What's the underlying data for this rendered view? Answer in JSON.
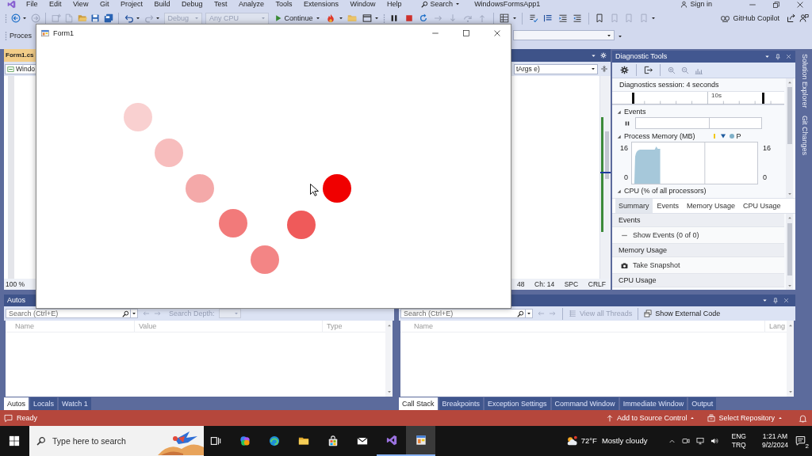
{
  "menu_bar": {
    "items": [
      "File",
      "Edit",
      "View",
      "Git",
      "Project",
      "Build",
      "Debug",
      "Test",
      "Analyze",
      "Tools",
      "Extensions",
      "Window",
      "Help"
    ],
    "search": "Search",
    "solution_name": "WindowsFormsApp1",
    "sign_in": "Sign in"
  },
  "toolbar": {
    "configuration": {
      "label": "Debug",
      "disabled": true
    },
    "platform": {
      "label": "Any CPU",
      "disabled": true
    },
    "continue": "Continue",
    "copilot": "GitHub Copilot"
  },
  "debug_location": {
    "label": "Proces"
  },
  "editor": {
    "tab": "Form1.cs",
    "type_dropdown": "Windo",
    "member_dropdown": "tArgs e)",
    "zoom": "100 %",
    "line": "48",
    "column": "Ch: 14",
    "whitespace": "SPC",
    "line_ending": "CRLF"
  },
  "form_window": {
    "title": "Form1",
    "circles": [
      {
        "color": "#f9d0d0"
      },
      {
        "color": "#f7bdbd"
      },
      {
        "color": "#f4a9a9"
      },
      {
        "color": "#f27a7a"
      },
      {
        "color": "#f38585"
      },
      {
        "color": "#ef5a5a"
      },
      {
        "color": "#f00000"
      }
    ]
  },
  "diagnostic_tools": {
    "title": "Diagnostic Tools",
    "session": "Diagnostics session: 4 seconds",
    "ruler_label": "10s",
    "graphs": [
      {
        "kind": "events",
        "label": "Events",
        "expanded": true
      },
      {
        "kind": "memory",
        "label": "Process Memory (MB)",
        "expanded": true,
        "legend_label": "P",
        "left_axis": [
          "16",
          "0"
        ],
        "right_axis": [
          "16",
          "0"
        ]
      },
      {
        "kind": "cpu",
        "label": "CPU (% of all processors)",
        "expanded": true
      }
    ],
    "tabs": [
      {
        "label": "Summary",
        "selected": true
      },
      {
        "label": "Events",
        "selected": false
      },
      {
        "label": "Memory Usage",
        "selected": false
      },
      {
        "label": "CPU Usage",
        "selected": false
      }
    ],
    "summary": [
      {
        "kind": "header",
        "label": "Events"
      },
      {
        "kind": "command",
        "label": "Show Events (0 of 0)"
      },
      {
        "kind": "header",
        "label": "Memory Usage"
      },
      {
        "kind": "command",
        "label": "Take Snapshot"
      },
      {
        "kind": "header",
        "label": "CPU Usage"
      }
    ]
  },
  "side_tabs": [
    "Solution Explorer",
    "Git Changes"
  ],
  "autos_panel": {
    "title": "Autos",
    "search_placeholder": "Search (Ctrl+E)",
    "search_depth": {
      "label": "Search Depth:",
      "disabled": true
    },
    "columns": [
      "Name",
      "Value",
      "Type"
    ],
    "tabs": [
      {
        "label": "Autos",
        "selected": true
      },
      {
        "label": "Locals",
        "selected": false
      },
      {
        "label": "Watch 1",
        "selected": false
      }
    ]
  },
  "call_stack_panel": {
    "search_placeholder": "Search (Ctrl+E)",
    "buttons": [
      {
        "label": "View all Threads",
        "disabled": true
      },
      {
        "label": "Show External Code",
        "disabled": false
      }
    ],
    "columns": [
      "Name",
      "Lang"
    ],
    "tabs": [
      {
        "label": "Call Stack",
        "selected": true
      },
      {
        "label": "Breakpoints",
        "selected": false
      },
      {
        "label": "Exception Settings",
        "selected": false
      },
      {
        "label": "Command Window",
        "selected": false
      },
      {
        "label": "Immediate Window",
        "selected": false
      },
      {
        "label": "Output",
        "selected": false
      }
    ]
  },
  "status_bar": {
    "message": "Ready",
    "source_control": "Add to Source Control",
    "repository": "Select Repository"
  },
  "taskbar": {
    "search_placeholder": "Type here to search",
    "apps": [
      {
        "running": false,
        "active": false
      },
      {
        "running": false,
        "active": false
      },
      {
        "running": false,
        "active": false
      },
      {
        "running": false,
        "active": false
      },
      {
        "running": false,
        "active": false
      },
      {
        "running": false,
        "active": false
      },
      {
        "running": true,
        "active": false
      },
      {
        "running": true,
        "active": true
      }
    ],
    "weather": {
      "temperature": "72°F",
      "condition": "Mostly cloudy"
    },
    "input_language": "ENG",
    "keyboard_layout": "TRQ",
    "time": "1:21 AM",
    "date": "9/2/2024",
    "notification_count": "2"
  }
}
